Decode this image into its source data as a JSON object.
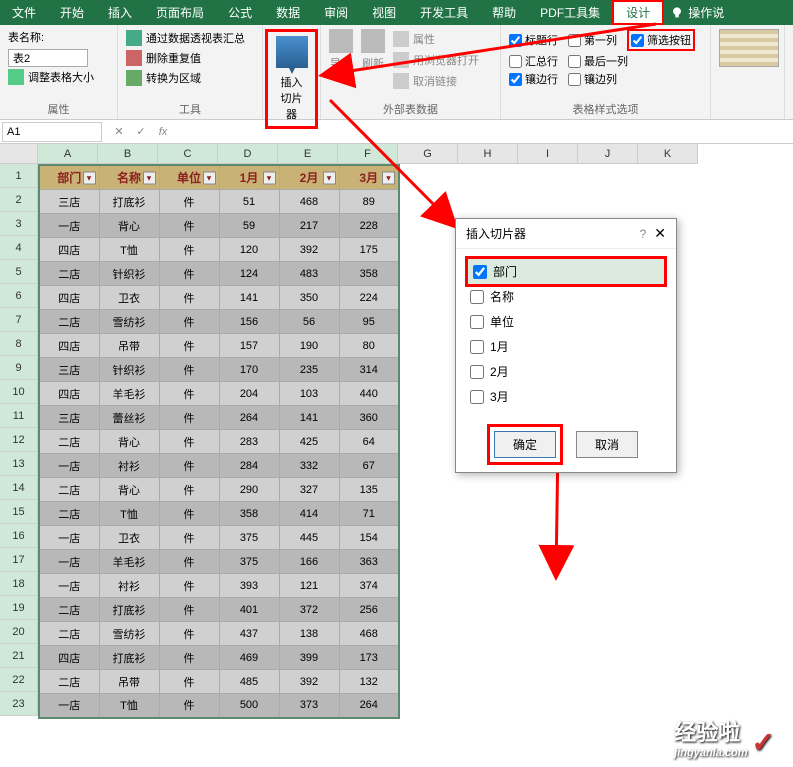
{
  "tabs": [
    "文件",
    "开始",
    "插入",
    "页面布局",
    "公式",
    "数据",
    "审阅",
    "视图",
    "开发工具",
    "帮助",
    "PDF工具集",
    "设计"
  ],
  "active_tab": "设计",
  "tell_me": "操作说",
  "ribbon": {
    "properties": {
      "label": "属性",
      "table_name_label": "表名称:",
      "table_name_value": "表2",
      "resize": "调整表格大小"
    },
    "tools": {
      "label": "工具",
      "pivot": "通过数据透视表汇总",
      "dedupe": "删除重复值",
      "convert": "转换为区域"
    },
    "slicer": {
      "label": "插入\n切片器"
    },
    "external": {
      "label": "外部表数据",
      "export": "导出",
      "refresh": "刷新",
      "props": "属性",
      "browser": "用浏览器打开",
      "unlink": "取消链接"
    },
    "style_opts": {
      "label": "表格样式选项",
      "header_row": "标题行",
      "first_col": "第一列",
      "filter_btn": "筛选按钮",
      "total_row": "汇总行",
      "last_col": "最后一列",
      "banded_row": "镶边行",
      "banded_col": "镶边列"
    }
  },
  "namebox": "A1",
  "columns": [
    "A",
    "B",
    "C",
    "D",
    "E",
    "F",
    "G",
    "H",
    "I",
    "J",
    "K"
  ],
  "headers": [
    "部门",
    "名称",
    "单位",
    "1月",
    "2月",
    "3月"
  ],
  "rows": [
    [
      "三店",
      "打底衫",
      "件",
      "51",
      "468",
      "89"
    ],
    [
      "一店",
      "背心",
      "件",
      "59",
      "217",
      "228"
    ],
    [
      "四店",
      "T恤",
      "件",
      "120",
      "392",
      "175"
    ],
    [
      "二店",
      "针织衫",
      "件",
      "124",
      "483",
      "358"
    ],
    [
      "四店",
      "卫衣",
      "件",
      "141",
      "350",
      "224"
    ],
    [
      "二店",
      "雪纺衫",
      "件",
      "156",
      "56",
      "95"
    ],
    [
      "四店",
      "吊带",
      "件",
      "157",
      "190",
      "80"
    ],
    [
      "三店",
      "针织衫",
      "件",
      "170",
      "235",
      "314"
    ],
    [
      "四店",
      "羊毛衫",
      "件",
      "204",
      "103",
      "440"
    ],
    [
      "三店",
      "蕾丝衫",
      "件",
      "264",
      "141",
      "360"
    ],
    [
      "二店",
      "背心",
      "件",
      "283",
      "425",
      "64"
    ],
    [
      "一店",
      "衬衫",
      "件",
      "284",
      "332",
      "67"
    ],
    [
      "二店",
      "背心",
      "件",
      "290",
      "327",
      "135"
    ],
    [
      "二店",
      "T恤",
      "件",
      "358",
      "414",
      "71"
    ],
    [
      "一店",
      "卫衣",
      "件",
      "375",
      "445",
      "154"
    ],
    [
      "一店",
      "羊毛衫",
      "件",
      "375",
      "166",
      "363"
    ],
    [
      "一店",
      "衬衫",
      "件",
      "393",
      "121",
      "374"
    ],
    [
      "二店",
      "打底衫",
      "件",
      "401",
      "372",
      "256"
    ],
    [
      "二店",
      "雪纺衫",
      "件",
      "437",
      "138",
      "468"
    ],
    [
      "四店",
      "打底衫",
      "件",
      "469",
      "399",
      "173"
    ],
    [
      "二店",
      "吊带",
      "件",
      "485",
      "392",
      "132"
    ],
    [
      "一店",
      "T恤",
      "件",
      "500",
      "373",
      "264"
    ]
  ],
  "dialog": {
    "title": "插入切片器",
    "fields": [
      "部门",
      "名称",
      "单位",
      "1月",
      "2月",
      "3月"
    ],
    "checked": [
      true,
      false,
      false,
      false,
      false,
      false
    ],
    "ok": "确定",
    "cancel": "取消"
  },
  "watermark": {
    "text": "经验啦",
    "sub": "jingyanla.com"
  }
}
